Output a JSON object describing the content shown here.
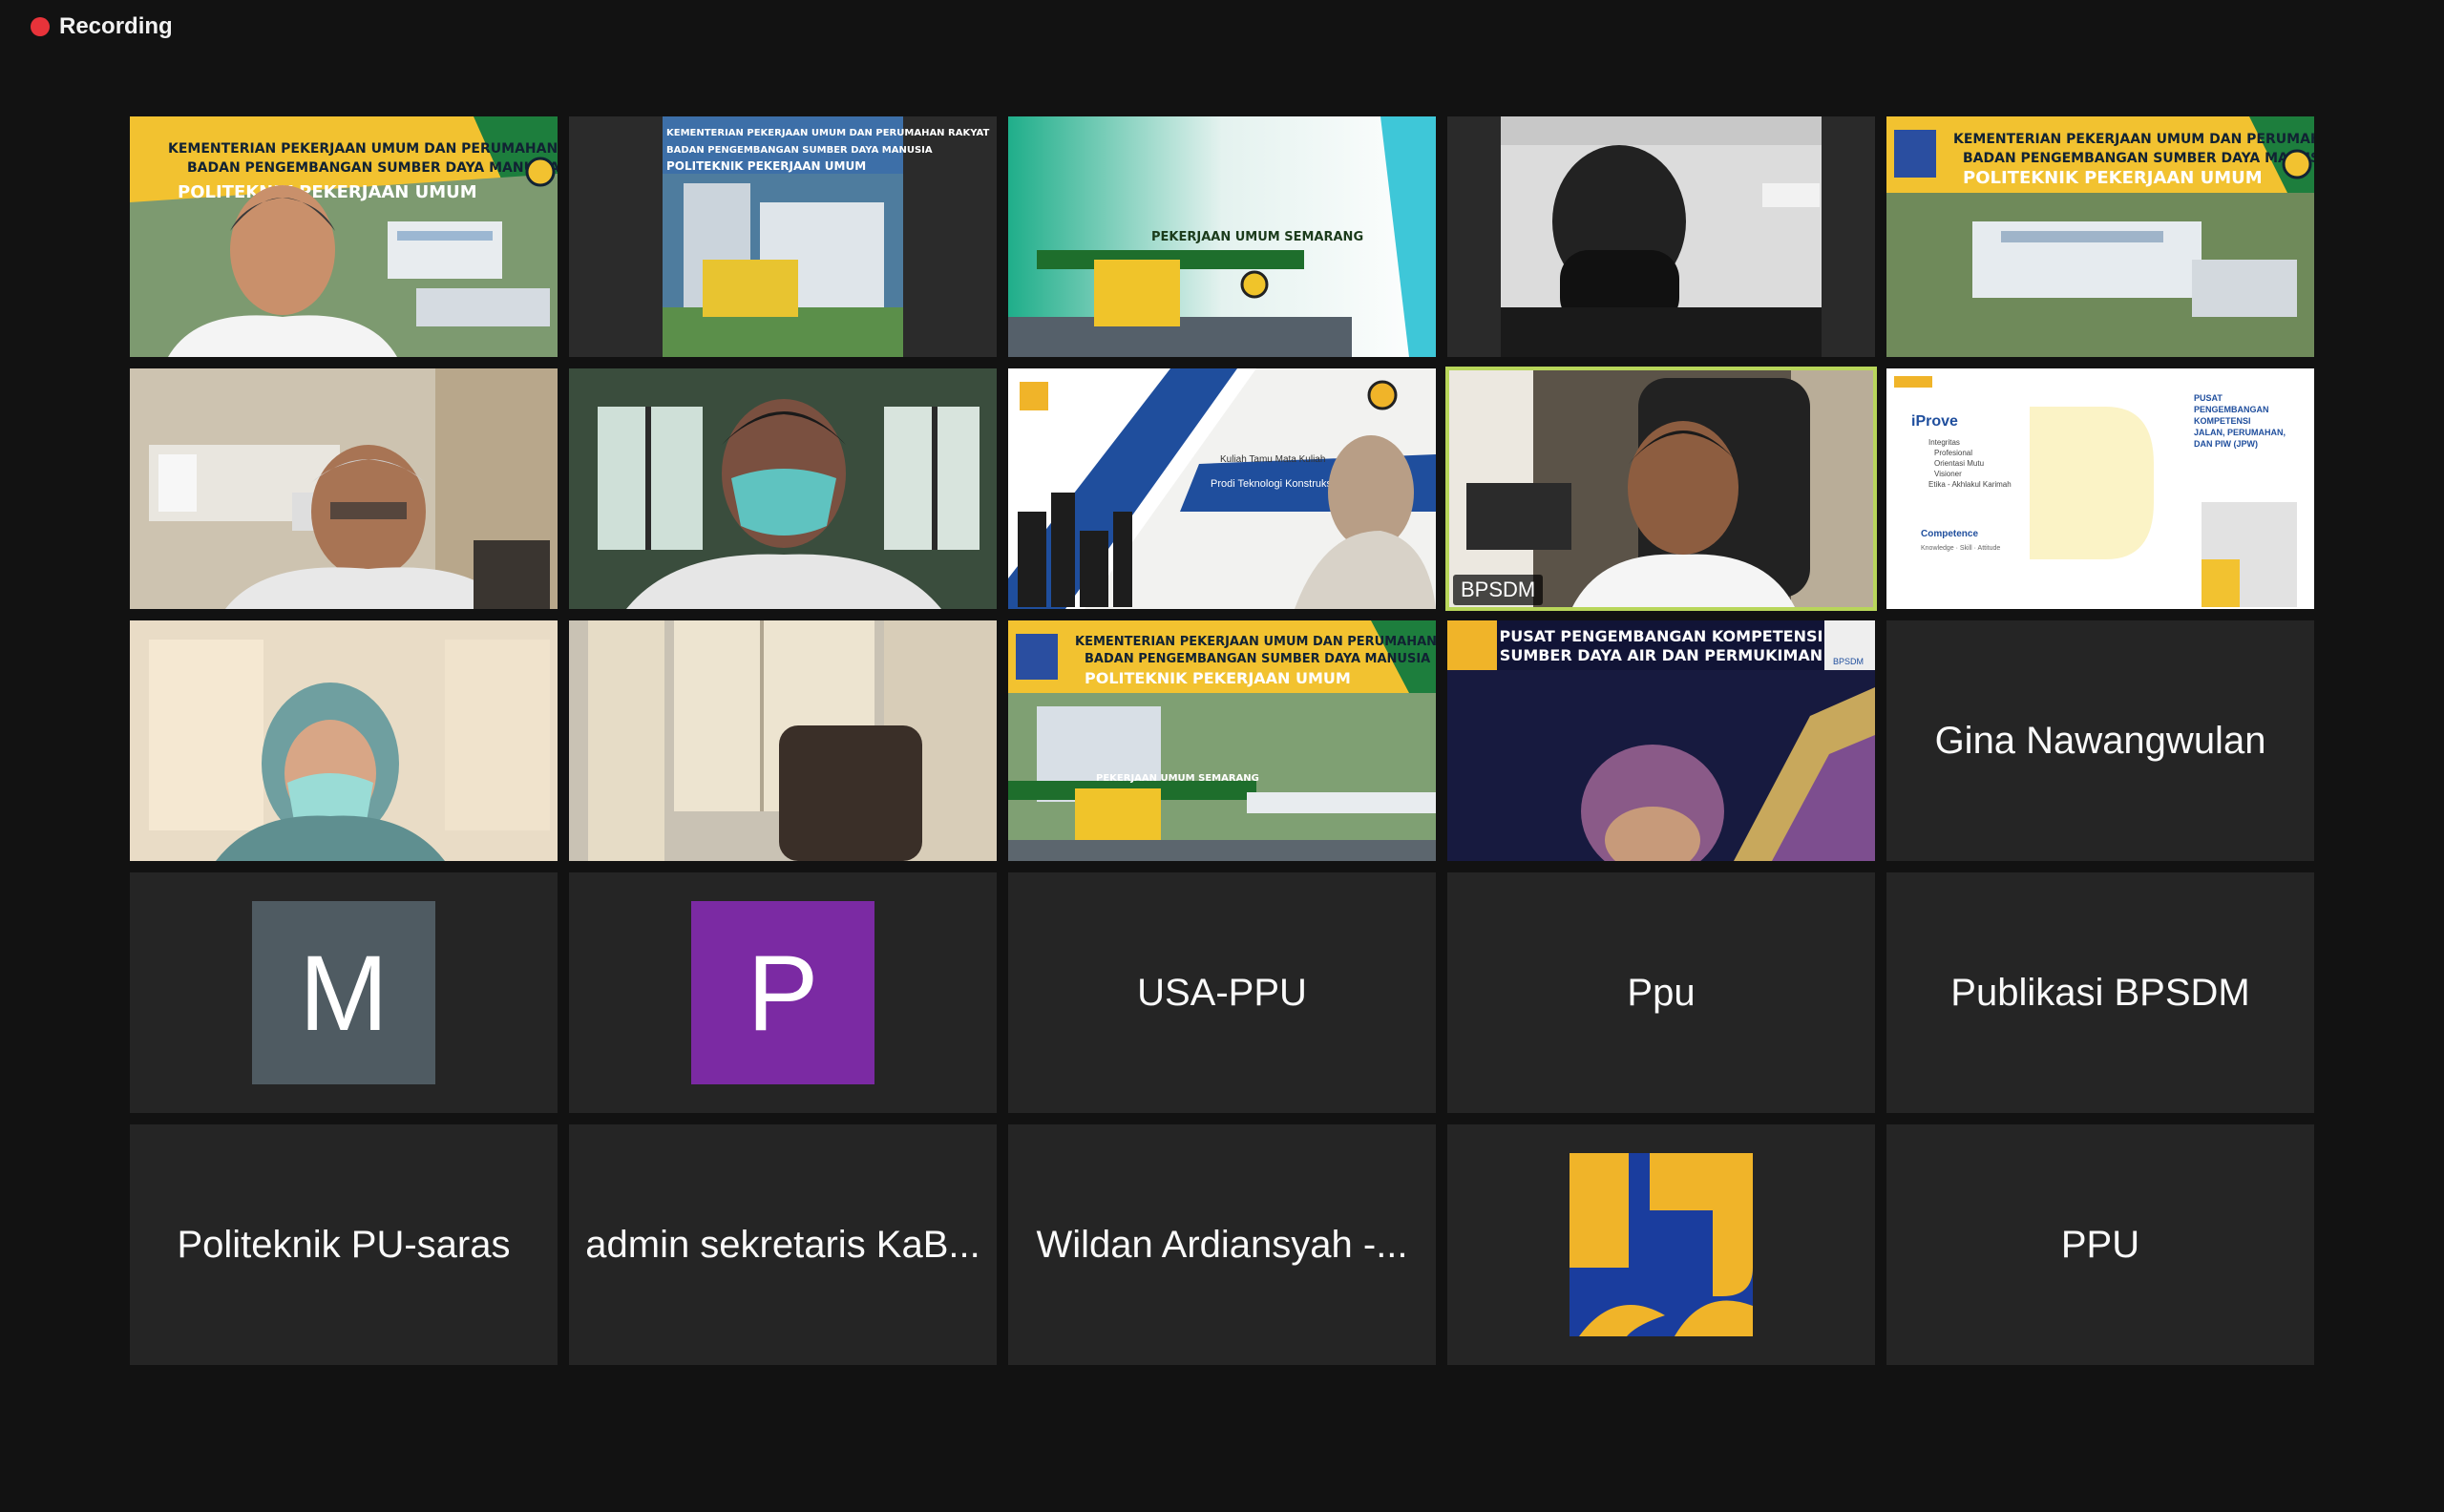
{
  "recording": {
    "label": "Recording",
    "dot_color": "#e8333a"
  },
  "colors": {
    "tile_bg": "#252525",
    "active_border": "#b8d65a",
    "page_bg": "#121212"
  },
  "participants": [
    {
      "id": 1,
      "kind": "video",
      "desc": "man-with-building-background"
    },
    {
      "id": 2,
      "kind": "video",
      "desc": "campus-slide"
    },
    {
      "id": 3,
      "kind": "video",
      "desc": "gate-slide"
    },
    {
      "id": 4,
      "kind": "video",
      "desc": "woman-with-mask"
    },
    {
      "id": 5,
      "kind": "video",
      "desc": "campus-aerial"
    },
    {
      "id": 6,
      "kind": "video",
      "desc": "man-with-glasses"
    },
    {
      "id": 7,
      "kind": "video",
      "desc": "man-with-mask"
    },
    {
      "id": 8,
      "kind": "video",
      "desc": "presentation-slide"
    },
    {
      "id": 9,
      "kind": "video",
      "label": "BPSDM",
      "active": true
    },
    {
      "id": 10,
      "kind": "video",
      "desc": "iprove-slide"
    },
    {
      "id": 11,
      "kind": "video",
      "desc": "woman-hijab-mask"
    },
    {
      "id": 12,
      "kind": "video",
      "desc": "empty-room"
    },
    {
      "id": 13,
      "kind": "video",
      "desc": "campus-gate-slide"
    },
    {
      "id": 14,
      "kind": "video",
      "desc": "pusat-banner"
    },
    {
      "id": 15,
      "kind": "name",
      "label": "Gina Nawangwulan"
    },
    {
      "id": 16,
      "kind": "avatar",
      "initial": "M",
      "color": "#4f5b62"
    },
    {
      "id": 17,
      "kind": "avatar",
      "initial": "P",
      "color": "#7b2aa3"
    },
    {
      "id": 18,
      "kind": "name",
      "label": "USA-PPU"
    },
    {
      "id": 19,
      "kind": "name",
      "label": "Ppu"
    },
    {
      "id": 20,
      "kind": "name",
      "label": "Publikasi BPSDM"
    },
    {
      "id": 21,
      "kind": "name",
      "label": "Politeknik PU-saras"
    },
    {
      "id": 22,
      "kind": "name",
      "label": "admin sekretaris KaB..."
    },
    {
      "id": 23,
      "kind": "name",
      "label": "Wildan Ardiansyah -..."
    },
    {
      "id": 24,
      "kind": "logo",
      "desc": "pu-logo",
      "colors": [
        "#1a3d9e",
        "#f0b429"
      ]
    },
    {
      "id": 25,
      "kind": "name",
      "label": "PPU"
    }
  ],
  "slides": {
    "kementerian_line1": "KEMENTERIAN PEKERJAAN UMUM DAN PERUMAHAN RAKYAT",
    "kementerian_line2": "BADAN PENGEMBANGAN SUMBER DAYA MANUSIA",
    "kementerian_line3": "POLITEKNIK PEKERJAAN UMUM",
    "gate_text": "PEKERJAAN UMUM SEMARANG",
    "slide8_line1": "Kuliah Tamu Mata Kuliah",
    "slide8_line2": "Prodi Teknologi Konstruksi",
    "iprove_title": "iProve",
    "iprove_items": [
      "Integritas",
      "Profesional",
      "Orientasi Mutu",
      "Visioner",
      "Etika - Akhlakul Karimah"
    ],
    "iprove_competence": "Competence",
    "iprove_competence_sub": "Knowledge · Skill · Attitude",
    "iprove_right": [
      "PUSAT",
      "PENGEMBANGAN",
      "KOMPETENSI",
      "JALAN, PERUMAHAN,",
      "DAN PIW (JPW)"
    ],
    "pusat_line1": "PUSAT PENGEMBANGAN KOMPETENSI",
    "pusat_line2": "SUMBER DAYA AIR DAN PERMUKIMAN",
    "bpsdm_logo": "BPSDM"
  }
}
